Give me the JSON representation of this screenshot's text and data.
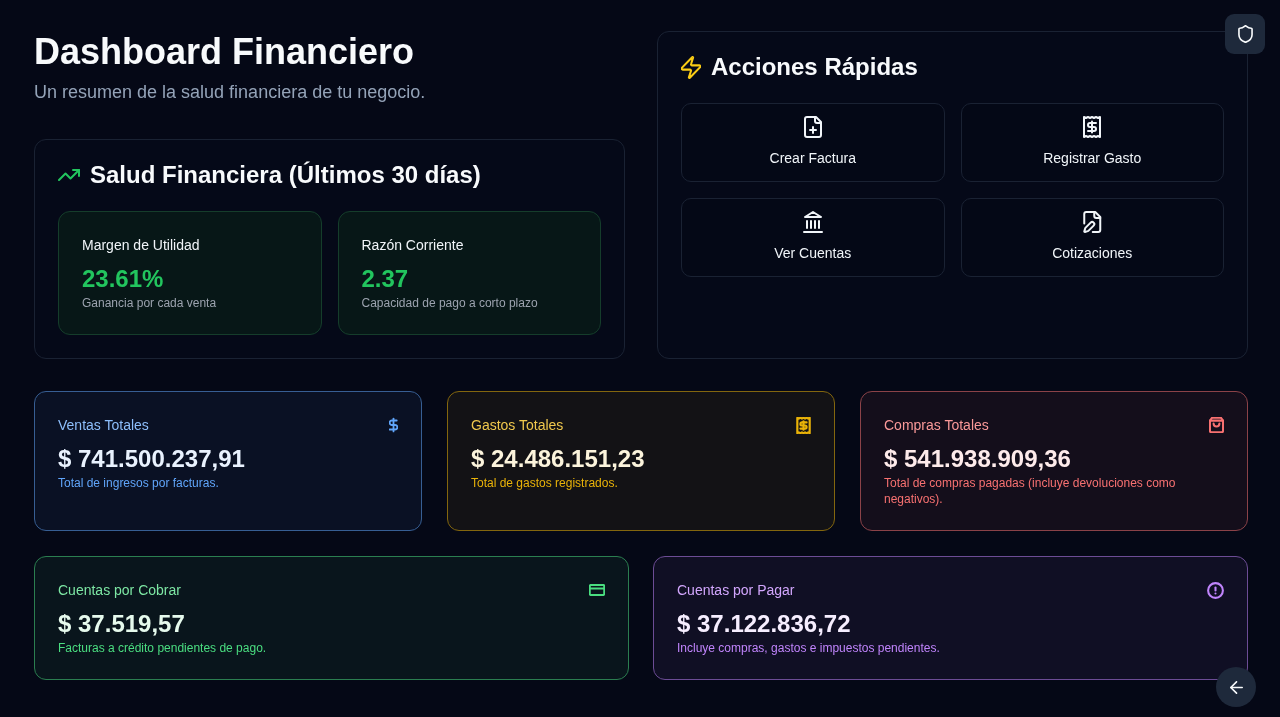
{
  "header": {
    "title": "Dashboard Financiero",
    "subtitle": "Un resumen de la salud financiera de tu negocio."
  },
  "health": {
    "title": "Salud Financiera (Últimos 30 días)",
    "metrics": [
      {
        "label": "Margen de Utilidad",
        "value": "23.61%",
        "description": "Ganancia por cada venta"
      },
      {
        "label": "Razón Corriente",
        "value": "2.37",
        "description": "Capacidad de pago a corto plazo"
      }
    ]
  },
  "quick_actions": {
    "title": "Acciones Rápidas",
    "actions": [
      {
        "label": "Crear Factura"
      },
      {
        "label": "Registrar Gasto"
      },
      {
        "label": "Ver Cuentas"
      },
      {
        "label": "Cotizaciones"
      }
    ]
  },
  "stat_rows": [
    {
      "cards": [
        {
          "label": "Ventas Totales",
          "value": "$ 741.500.237,91",
          "description": "Total de ingresos por facturas.",
          "color": "#60a5fa"
        },
        {
          "label": "Gastos Totales",
          "value": "$ 24.486.151,23",
          "description": "Total de gastos registrados.",
          "color": "#eab308"
        },
        {
          "label": "Compras Totales",
          "value": "$ 541.938.909,36",
          "description": "Total de compras pagadas (incluye devoluciones como negativos).",
          "color": "#f87171"
        }
      ]
    },
    {
      "cards": [
        {
          "label": "Cuentas por Cobrar",
          "value": "$ 37.519,57",
          "description": "Facturas a crédito pendientes de pago.",
          "color": "#4ade80"
        },
        {
          "label": "Cuentas por Pagar",
          "value": "$ 37.122.836,72",
          "description": "Incluye compras, gastos e impuestos pendientes.",
          "color": "#c084fc"
        }
      ]
    }
  ]
}
